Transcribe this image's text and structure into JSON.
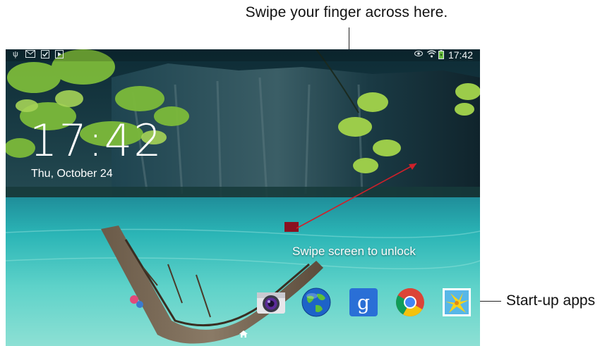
{
  "callouts": {
    "swipe": "Swipe your finger across here.",
    "apps": "Start-up apps"
  },
  "status_bar": {
    "left_icons": [
      "usb-icon",
      "gmail-icon",
      "task-icon",
      "play-store-icon"
    ],
    "right_icons": [
      "smart-stay-eye-icon",
      "wifi-icon",
      "battery-charging-icon"
    ],
    "time": "17:42"
  },
  "lock_screen": {
    "clock": "17:42",
    "date": "Thu, October 24",
    "unlock_hint": "Swipe screen to unlock"
  },
  "apps": [
    {
      "name": "camera-icon"
    },
    {
      "name": "internet-globe-icon"
    },
    {
      "name": "google-search-icon",
      "glyph": "g"
    },
    {
      "name": "chrome-icon"
    },
    {
      "name": "gallery-icon"
    }
  ],
  "colors": {
    "arrow": "#d0202a",
    "sea": "#2bb7b5",
    "cliff": "#1d3d47",
    "leaves": "#8cc63e"
  }
}
